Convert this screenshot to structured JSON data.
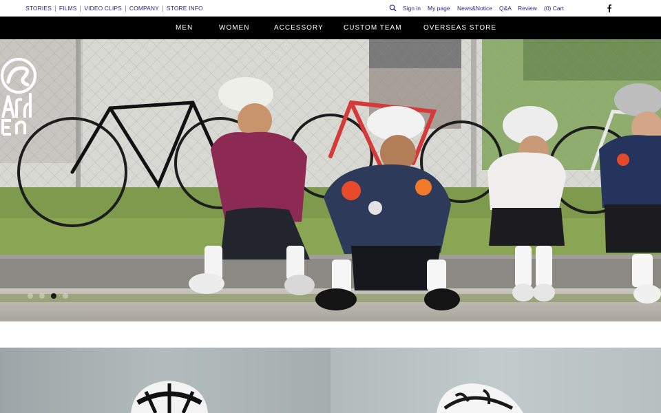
{
  "utility_nav": {
    "left_links": [
      "STORIES",
      "FILMS",
      "VIDEO CLIPS",
      "COMPANY",
      "STORE INFO"
    ],
    "right_links": [
      "Sign in",
      "My page",
      "News&Notice",
      "Q&A",
      "Review",
      "(0) Cart"
    ]
  },
  "main_nav": {
    "items": [
      "MEN",
      "WOMEN",
      "ACCESSORY",
      "CUSTOM TEAM",
      "OVERSEAS STORE"
    ]
  },
  "hero": {
    "slide_count": 4,
    "active_slide": 3
  },
  "colors": {
    "link": "#1f1f8a",
    "nav_bg": "#000000",
    "nav_text": "#ffffff"
  },
  "icons": [
    "search-icon",
    "facebook-icon",
    "brand-logo"
  ]
}
